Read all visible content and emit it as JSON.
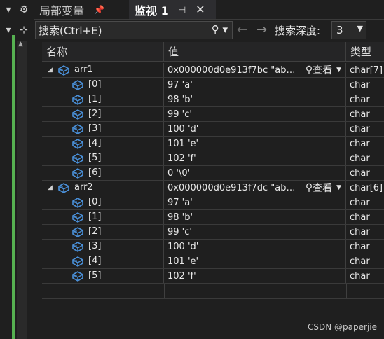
{
  "tabs": {
    "locals_label": "局部变量",
    "watch_label": "监视 1",
    "pin_glyph": "📌",
    "close_glyph": "✕"
  },
  "toolbar": {
    "search_placeholder": "搜索(Ctrl+E)",
    "depth_label": "搜索深度:",
    "depth_value": "3"
  },
  "columns": {
    "name": "名称",
    "value": "值",
    "type": "类型"
  },
  "rows": [
    {
      "level": 0,
      "expanded": true,
      "name": "arr1",
      "value": "0x000000d0e913f7bc \"ab…",
      "type": "char[7]",
      "view_label": "查看"
    },
    {
      "level": 1,
      "name": "[0]",
      "value": "97 'a'",
      "type": "char"
    },
    {
      "level": 1,
      "name": "[1]",
      "value": "98 'b'",
      "type": "char"
    },
    {
      "level": 1,
      "name": "[2]",
      "value": "99 'c'",
      "type": "char"
    },
    {
      "level": 1,
      "name": "[3]",
      "value": "100 'd'",
      "type": "char"
    },
    {
      "level": 1,
      "name": "[4]",
      "value": "101 'e'",
      "type": "char"
    },
    {
      "level": 1,
      "name": "[5]",
      "value": "102 'f'",
      "type": "char"
    },
    {
      "level": 1,
      "name": "[6]",
      "value": "0 '\\0'",
      "type": "char"
    },
    {
      "level": 0,
      "expanded": true,
      "name": "arr2",
      "value": "0x000000d0e913f7dc \"ab…",
      "type": "char[6]",
      "view_label": "查看"
    },
    {
      "level": 1,
      "name": "[0]",
      "value": "97 'a'",
      "type": "char"
    },
    {
      "level": 1,
      "name": "[1]",
      "value": "98 'b'",
      "type": "char"
    },
    {
      "level": 1,
      "name": "[2]",
      "value": "99 'c'",
      "type": "char"
    },
    {
      "level": 1,
      "name": "[3]",
      "value": "100 'd'",
      "type": "char"
    },
    {
      "level": 1,
      "name": "[4]",
      "value": "101 'e'",
      "type": "char"
    },
    {
      "level": 1,
      "name": "[5]",
      "value": "102 'f'",
      "type": "char"
    }
  ],
  "watermark": "CSDN @paperjie",
  "colors": {
    "accent_green": "#56b151",
    "background": "#1f1f1f",
    "icon_blue": "#4a90d9"
  }
}
